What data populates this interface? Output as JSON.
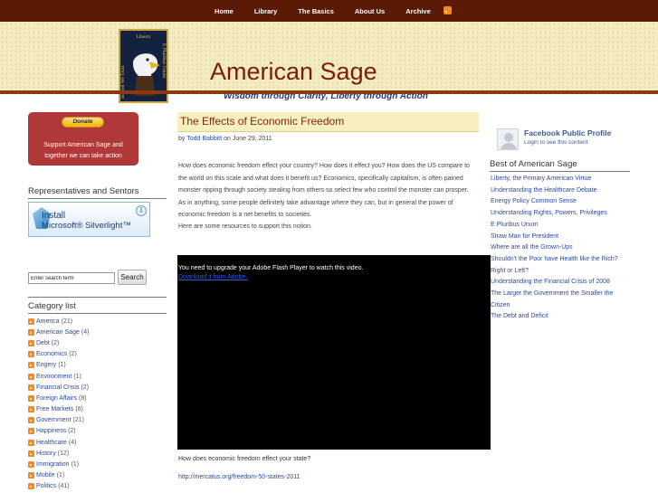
{
  "nav": {
    "items": [
      "Home",
      "Library",
      "The Basics",
      "About Us",
      "Archive"
    ],
    "rss_icon": "rss-feed-icon"
  },
  "logo": {
    "top_text": "Liberty",
    "left_text": "In God We Trust",
    "right_text": "E Pluribus Unum",
    "icon": "eagle-icon"
  },
  "site": {
    "title": "American Sage",
    "tagline": "Wisdom through Clarity, Liberty through Action"
  },
  "donate": {
    "button_label": "Donate",
    "text": "Support American Sage and together we can take action"
  },
  "representatives": {
    "heading": "Representatives and Sentors",
    "silverlight_line1": "Install",
    "silverlight_line2": "Microsoft® Silverlight™"
  },
  "search": {
    "value": "Enter search term",
    "button_label": "Search"
  },
  "categories": {
    "heading": "Category list",
    "items": [
      {
        "label": "America",
        "count": "(21)"
      },
      {
        "label": "American Sage",
        "count": "(4)"
      },
      {
        "label": "Debt",
        "count": "(2)"
      },
      {
        "label": "Economics",
        "count": "(2)"
      },
      {
        "label": "Engery",
        "count": "(1)"
      },
      {
        "label": "Environment",
        "count": "(1)"
      },
      {
        "label": "Financial Crisis",
        "count": "(2)"
      },
      {
        "label": "Foreign Affairs",
        "count": "(8)"
      },
      {
        "label": "Free Markets",
        "count": "(6)"
      },
      {
        "label": "Government",
        "count": "(21)"
      },
      {
        "label": "Happiness",
        "count": "(2)"
      },
      {
        "label": "Healthcare",
        "count": "(4)"
      },
      {
        "label": "History",
        "count": "(12)"
      },
      {
        "label": "Immigration",
        "count": "(1)"
      },
      {
        "label": "Mobile",
        "count": "(1)"
      },
      {
        "label": "Politics",
        "count": "(41)"
      }
    ]
  },
  "post": {
    "title": "The Effects of Economic Freedom",
    "by": "by",
    "author": "Todd Babbitt",
    "date_text": "on June 29, 2011",
    "paragraph1": "How does economic freedom effect your country? How does it effect you? How does the US compare to the world on this scale and what does it benefit us? Economics, specifically capitalism, is often pained monster ripping through society stealing from others so select few who control the monster can prosper. As in anything, some people definitely take advantage where they can, but in general the power of economic freedom is a net benefits to societies.",
    "paragraph2": "Here are some resources to support this notion.",
    "video_message": "You need to upgrade your Adobe Flash Player to watch this video.",
    "video_link": "Download it from Adobe.",
    "question": "How does economic freedom effect your state?",
    "link": "http://mercatus.org/freedom-50-states-2011"
  },
  "facebook": {
    "title": "Facebook Public Profile",
    "subtitle": "Login to see this content"
  },
  "best": {
    "heading": "Best of American Sage",
    "items": [
      "Liberty, the Primary American Virtue",
      "Understanding the Healthcare Debate",
      "Energy Policy Common Sense",
      "Understanding Rights, Powers, Privileges",
      "E Pluribus Unum",
      "Straw Man for President",
      "Where are all the Grown-Ups",
      "Shouldn't the Poor have Health like the Rich? Right or Left?",
      "Understanding the Financial Crisis of 2008",
      "The Larger the Government the Smaller the Citizen",
      "The Debt and Deficit"
    ]
  },
  "colors": {
    "topbar": "#5a1a05",
    "title": "#7a1c0c",
    "tagline": "#2a3a7a",
    "link": "#2a4a9a",
    "donate_bg": "#b03838"
  }
}
